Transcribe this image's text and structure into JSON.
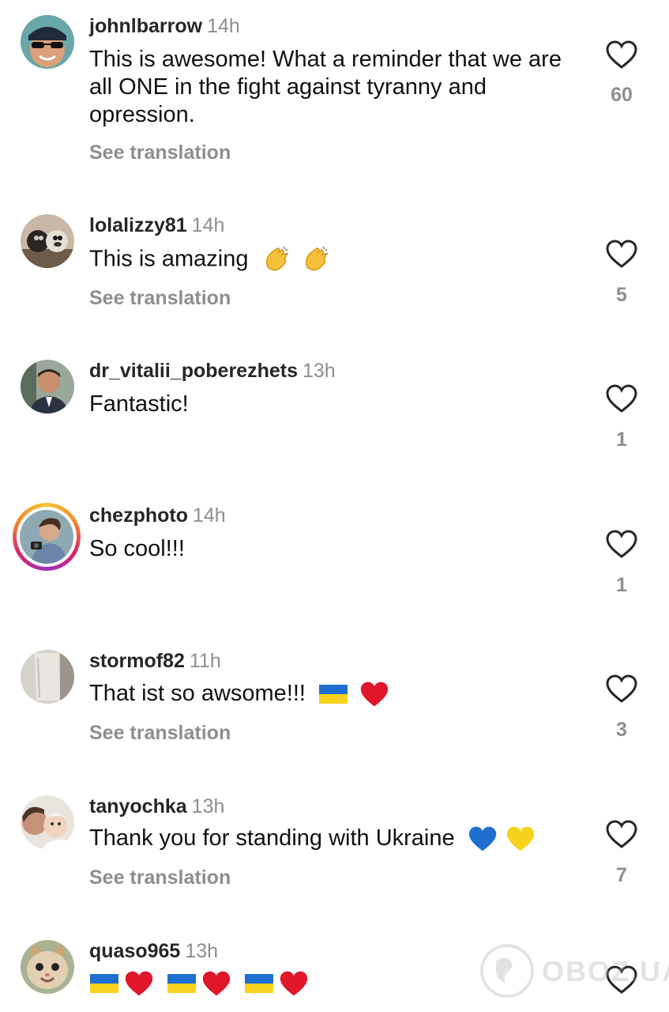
{
  "see_translation_label": "See translation",
  "watermark": "OBOZ.UA",
  "comments": [
    {
      "username": "johnlbarrow",
      "time": "14h",
      "text": "This is awesome!  What a reminder that we are all ONE in the fight against tyranny and opression.",
      "likes": "60",
      "has_translation": true,
      "avatar": "avatar-man-sunglasses-cap"
    },
    {
      "username": "lolalizzy81",
      "time": "14h",
      "text": "This is amazing",
      "emoji": [
        "clapping-hands-emoji",
        "clapping-hands-emoji"
      ],
      "likes": "5",
      "has_translation": true,
      "avatar": "avatar-dogs"
    },
    {
      "username": "dr_vitalii_poberezhets",
      "time": "13h",
      "text": "Fantastic!",
      "likes": "1",
      "has_translation": false,
      "avatar": "avatar-man-suit"
    },
    {
      "username": "chezphoto",
      "time": "14h",
      "text": "So cool!!!",
      "likes": "1",
      "has_translation": false,
      "avatar": "avatar-photographer-story-ring"
    },
    {
      "username": "stormof82",
      "time": "11h",
      "text": "That ist so awsome!!!",
      "emoji": [
        "ukraine-flag-emoji",
        "red-heart-emoji"
      ],
      "likes": "3",
      "has_translation": true,
      "avatar": "avatar-grey"
    },
    {
      "username": "tanyochka",
      "time": "13h",
      "text": "Thank you for standing with Ukraine",
      "emoji": [
        "blue-heart-emoji",
        "yellow-heart-emoji"
      ],
      "likes": "7",
      "has_translation": true,
      "avatar": "avatar-mother-baby"
    },
    {
      "username": "quaso965",
      "time": "13h",
      "text": "",
      "emoji": [
        "ukraine-flag-emoji",
        "red-heart-emoji",
        "ukraine-flag-emoji",
        "red-heart-emoji",
        "ukraine-flag-emoji",
        "red-heart-emoji"
      ],
      "likes": "",
      "has_translation": false,
      "avatar": "avatar-cat"
    }
  ],
  "colors": {
    "username": "#262626",
    "secondary_text": "#8e8e8e",
    "ukraine_blue": "#1f6fd1",
    "ukraine_yellow": "#f7d21c",
    "heart_red": "#e0162b"
  }
}
